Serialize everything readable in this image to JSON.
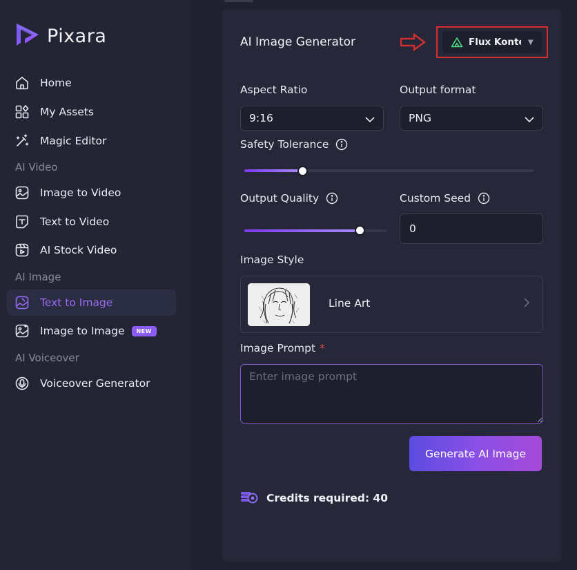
{
  "brand": {
    "name": "Pixara",
    "logo_icon": "pixara-play-logo"
  },
  "sidebar": {
    "items": [
      {
        "label": "Home",
        "icon": "home-icon"
      },
      {
        "label": "My Assets",
        "icon": "assets-grid-icon"
      },
      {
        "label": "Magic Editor",
        "icon": "magic-wand-icon"
      },
      {
        "label": "Image to Video",
        "icon": "image-video-icon"
      },
      {
        "label": "Text to Video",
        "icon": "text-video-icon"
      },
      {
        "label": "AI Stock Video",
        "icon": "stock-video-icon"
      },
      {
        "label": "Text to Image",
        "icon": "text-image-icon",
        "active": true
      },
      {
        "label": "Image to Image",
        "icon": "image-image-icon",
        "badge": "NEW"
      },
      {
        "label": "Voiceover Generator",
        "icon": "voiceover-icon"
      }
    ],
    "sections": {
      "ai_video": "AI Video",
      "ai_image": "AI Image",
      "ai_voiceover": "AI Voiceover"
    }
  },
  "panel": {
    "title": "AI Image Generator",
    "model": {
      "label": "Flux Kontext",
      "icon": "flux-triangle-icon"
    },
    "aspect_ratio": {
      "label": "Aspect Ratio",
      "value": "9:16"
    },
    "output_format": {
      "label": "Output format",
      "value": "PNG"
    },
    "safety_tolerance": {
      "label": "Safety Tolerance",
      "level": 0.2
    },
    "output_quality": {
      "label": "Output Quality",
      "level": 0.81
    },
    "custom_seed": {
      "label": "Custom Seed",
      "value": "0"
    },
    "image_style": {
      "label": "Image Style",
      "value": "Line Art"
    },
    "image_prompt": {
      "label": "Image Prompt",
      "required_mark": "*",
      "placeholder": "Enter image prompt"
    },
    "generate_label": "Generate AI Image",
    "credits_label": "Credits required: 40"
  },
  "colors": {
    "accent": "#8b5cf6",
    "highlight_red": "#d32f2f",
    "panel_bg": "#262839",
    "sidebar_bg": "#232535"
  }
}
